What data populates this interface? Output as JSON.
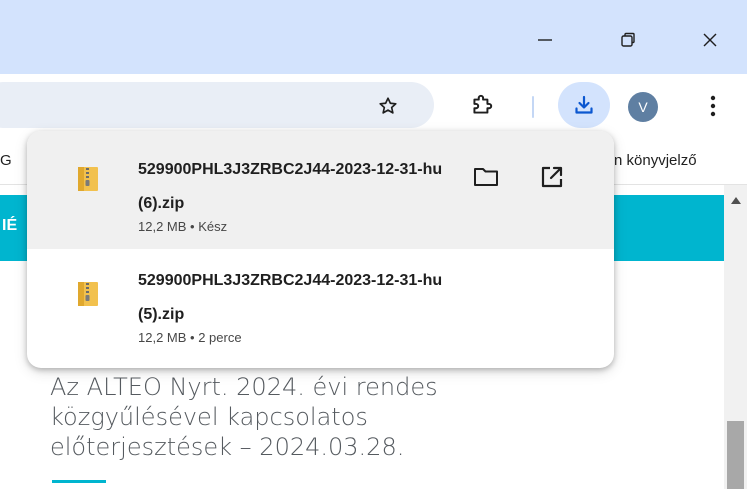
{
  "window": {
    "controls": [
      {
        "name": "minimize",
        "icon": "minimize-icon"
      },
      {
        "name": "restore",
        "icon": "restore-icon"
      },
      {
        "name": "close",
        "icon": "close-icon"
      }
    ]
  },
  "toolbar": {
    "profile_initial": "V",
    "icons": [
      "star-icon",
      "extensions-puzzle-icon",
      "download-icon",
      "more-vert-icon"
    ]
  },
  "bookmarks": {
    "left_fragment": "G",
    "right_label": "n könyvjelző"
  },
  "page": {
    "banner_fragment": "IÉ",
    "headline": "Az ALTEO Nyrt. 2024. évi rendes\nközgyűlésével kapcsolatos\nelőterjesztések – 2024.03.28."
  },
  "downloads": {
    "items": [
      {
        "name_line1": "529900PHL3J3ZRBC2J44-2023-12-31-hu",
        "name_line2": "(6).zip",
        "size": "12,2 MB",
        "status": "Kész",
        "meta": "12,2 MB • Kész"
      },
      {
        "name_line1": "529900PHL3J3ZRBC2J44-2023-12-31-hu",
        "name_line2": "(5).zip",
        "size": "12,2 MB",
        "status": "2 perce",
        "meta": "12,2 MB • 2 perce"
      }
    ]
  },
  "colors": {
    "titlebar": "#d3e3fd",
    "download_button_active": "#d3e3fd",
    "download_icon": "#0b57d0",
    "teal_banner": "#00b5cf",
    "avatar": "#5f7fa2"
  }
}
